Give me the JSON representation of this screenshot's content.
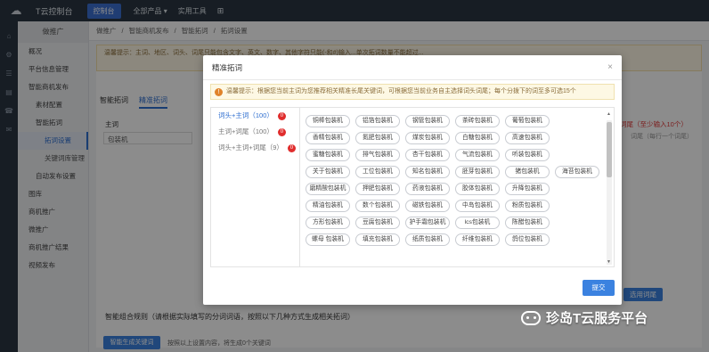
{
  "topbar": {
    "logo": "☁",
    "brand": "T云控制台",
    "tab_active": "控制台",
    "menu_products": "全部产品 ▾",
    "menu_tools": "实用工具",
    "plus": "⊞"
  },
  "iconrail": [
    "⌂",
    "⚙",
    "☰",
    "▤",
    "☎",
    "✉"
  ],
  "sidebar": {
    "title": "做推广",
    "items": [
      {
        "label": "概况",
        "level": 0,
        "active": false
      },
      {
        "label": "平台信息管理",
        "level": 0,
        "active": false
      },
      {
        "label": "智能商机发布",
        "level": 0,
        "active": false
      },
      {
        "label": "素材配置",
        "level": 1,
        "active": false
      },
      {
        "label": "智能拓词",
        "level": 1,
        "active": false
      },
      {
        "label": "拓词设置",
        "level": 2,
        "active": true
      },
      {
        "label": "关键词库管理",
        "level": 2,
        "active": false
      },
      {
        "label": "自动发布设置",
        "level": 1,
        "active": false
      },
      {
        "label": "图库",
        "level": 0,
        "active": false
      },
      {
        "label": "商机推广",
        "level": 0,
        "active": false
      },
      {
        "label": "微推广",
        "level": 0,
        "active": false
      },
      {
        "label": "商机推广结果",
        "level": 0,
        "active": false
      },
      {
        "label": "视频发布",
        "level": 0,
        "active": false
      }
    ]
  },
  "breadcrumb": [
    "做推广",
    "智能商机发布",
    "智能拓词",
    "拓词设置"
  ],
  "main": {
    "warning": "温馨提示：主词、地区、词头、词尾只能包含文字、英文、数字、其他字符只能(-和#)输入...单次拓词数量不能超过...",
    "tabs": [
      "智能拓词",
      "精准拓词"
    ],
    "kw_label": "主词",
    "kw_value": "包装机",
    "right_hint": "词尾（至少输入10个）",
    "right_hint2": "词尾（每行一个词尾）",
    "apply_button": "选用词尾",
    "rule_title": "智能组合规则（请根据实际填写的分词词语，按照以下几种方式生成相关拓词）",
    "gen_button": "智能生成关键词",
    "gen_note": "按照以上设置内容，将生成0个关键词"
  },
  "modal": {
    "title": "精准拓词",
    "close": "×",
    "warn_icon": "!",
    "warning": "温馨提示：根据您当前主词为您推荐相关精准长尾关键词，可根据您当前业务自主选择词头词尾；每个分拨下的词至多可选15个",
    "groups": [
      {
        "label": "词头+主词（100）",
        "count": "0",
        "active": true
      },
      {
        "label": "主词+词尾（100）",
        "count": "0",
        "active": false
      },
      {
        "label": "词头+主词+词尾（9）",
        "count": "0",
        "active": false
      }
    ],
    "chips": [
      [
        "铜棒包装机",
        "铝箔包装机",
        "钢管包装机",
        "茶砖包装机",
        "葡萄包装机"
      ],
      [
        "香精包装机",
        "氮肥包装机",
        "煤炭包装机",
        "白糖包装机",
        "高速包装机"
      ],
      [
        "蜜糖包装机",
        "排气包装机",
        "杏干包装机",
        "气流包装机",
        "听装包装机"
      ],
      [
        "关于包装机",
        "工位包装机",
        "知名包装机",
        "胚芽包装机",
        "猪包装机",
        "海苔包装机"
      ],
      [
        "磨精酸包装机",
        "押肥包装机",
        "药液包装机",
        "胶体包装机",
        "升降包装机"
      ],
      [
        "精油包装机",
        "数个包装机",
        "磁铁包装机",
        "中岛包装机",
        "粉质包装机"
      ],
      [
        "方形包装机",
        "豆腐包装机",
        "护手霜包装机",
        "lcs包装机",
        "陈醋包装机"
      ],
      [
        "螺母 包装机",
        "填充包装机",
        "纸质包装机",
        "纤维包装机",
        "鸽位包装机"
      ]
    ],
    "submit": "提交"
  },
  "watermark": "珍岛T云服务平台"
}
